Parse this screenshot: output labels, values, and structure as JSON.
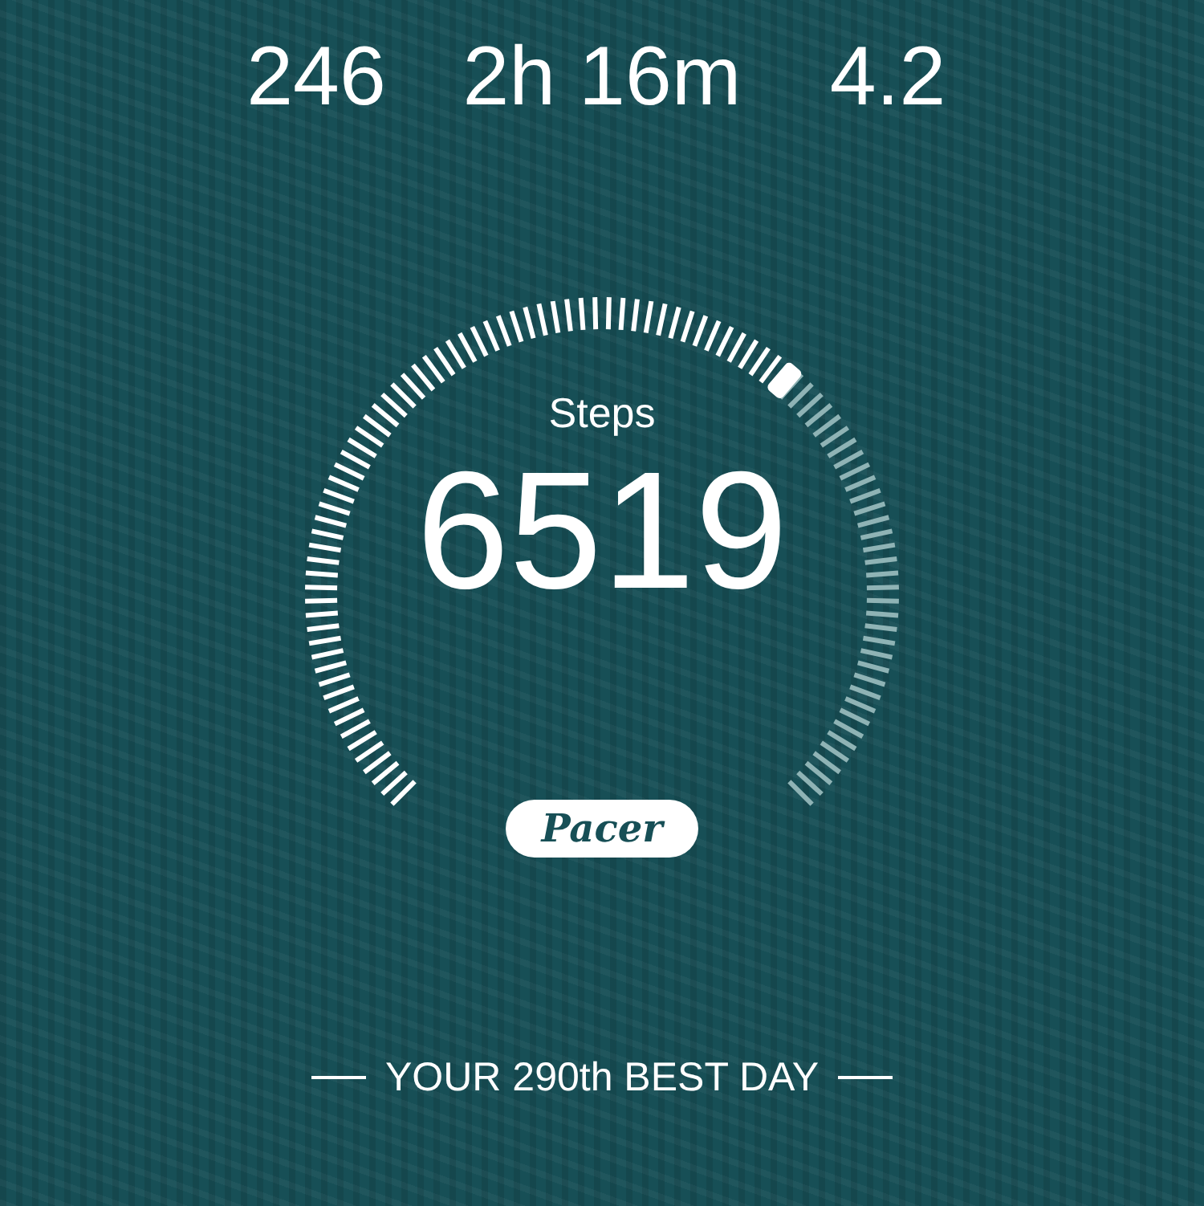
{
  "stats": [
    {
      "value": "246"
    },
    {
      "value": "2h 16m"
    },
    {
      "value": "4.2"
    }
  ],
  "gauge": {
    "label": "Steps",
    "value": "6519"
  },
  "badge": "Pacer",
  "footer": "YOUR 290th BEST DAY"
}
